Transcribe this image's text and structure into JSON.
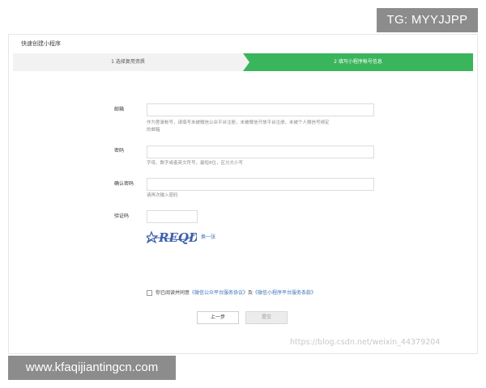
{
  "watermarks": {
    "tg": "TG: MYYJJPP",
    "site": "www.kfaqijiantingcn.com",
    "csdn": "https://blog.csdn.net/weixin_44379204"
  },
  "window": {
    "title": "快速创建小程序"
  },
  "steps": [
    {
      "label": "1 选择复用资质",
      "active": false
    },
    {
      "label": "2 填写小程序帐号信息",
      "active": true
    }
  ],
  "form": {
    "email": {
      "label": "邮箱",
      "value": "",
      "hint_line1": "作为登录帐号，请填写未被微信公众平台注册，未被微信开放平台注册，未被个人微信号绑定",
      "hint_line2": "的邮箱"
    },
    "password": {
      "label": "密码",
      "value": "",
      "hint": "字母、数字或者英文符号，最短8位，区分大小写"
    },
    "confirm_password": {
      "label": "确认密码",
      "value": "",
      "hint": "请再次输入密码"
    },
    "captcha": {
      "label": "验证码",
      "value": "",
      "image_text": "REQD",
      "refresh_label": "换一张"
    }
  },
  "agreement": {
    "prefix": "你已阅读并同意",
    "link1": "《微信公众平台服务协议》",
    "joiner": "及",
    "link2": "《微信小程序平台服务条款》",
    "checked": false
  },
  "buttons": {
    "prev": "上一步",
    "submit": "提交"
  },
  "colors": {
    "accent_green": "#3ab55b",
    "link_blue": "#3a6fb5"
  }
}
